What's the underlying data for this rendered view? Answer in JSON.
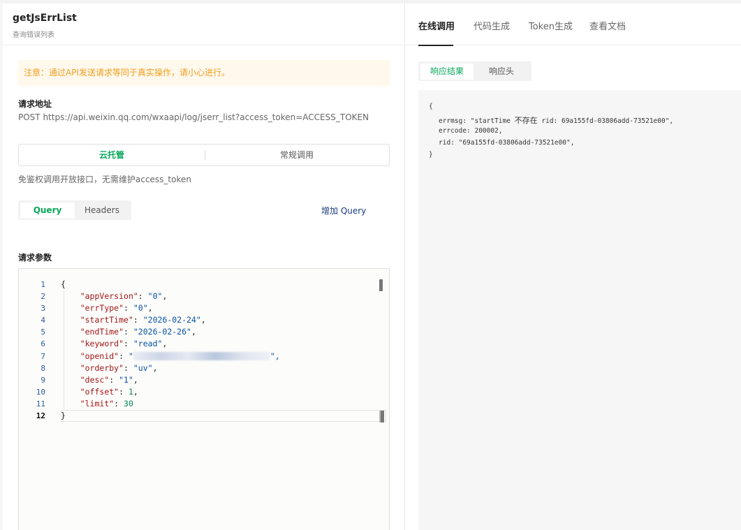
{
  "api": {
    "title": "getJsErrList",
    "subtitle": "查询错误列表"
  },
  "notice": "注意：通过API发送请求等同于真实操作，请小心进行。",
  "request_url": {
    "label": "请求地址",
    "value": "POST https://api.weixin.qq.com/wxaapi/log/jserr_list?access_token=ACCESS_TOKEN"
  },
  "mode_switch": {
    "options": [
      "云托管",
      "常规调用"
    ],
    "selected": "云托管"
  },
  "hint": "免鉴权调用开放接口，无需维护access_token",
  "param_tabs": {
    "tabs": [
      "Query",
      "Headers"
    ],
    "active": "Query",
    "add_label": "增加 Query"
  },
  "params_label": "请求参数",
  "editor": {
    "line_numbers": [
      "1",
      "2",
      "3",
      "4",
      "5",
      "6",
      "7",
      "8",
      "9",
      "10",
      "11",
      "12"
    ],
    "current_line": "12",
    "open_brace": "{",
    "close_brace": "}",
    "entries": [
      {
        "key": "\"appVersion\"",
        "value": "\"0\"",
        "kind": "s",
        "sep": ","
      },
      {
        "key": "\"errType\"",
        "value": "\"0\"",
        "kind": "s",
        "sep": ","
      },
      {
        "key": "\"startTime\"",
        "value": "\"2026-02-24\"",
        "kind": "s",
        "sep": ","
      },
      {
        "key": "\"endTime\"",
        "value": "\"2026-02-26\"",
        "kind": "s",
        "sep": ","
      },
      {
        "key": "\"keyword\"",
        "value": "\"read\"",
        "kind": "s",
        "sep": ","
      },
      {
        "key": "\"openid\"",
        "value": "\"",
        "kind": "s",
        "sep": "\",",
        "redacted": true
      },
      {
        "key": "\"orderby\"",
        "value": "\"uv\"",
        "kind": "s",
        "sep": ","
      },
      {
        "key": "\"desc\"",
        "value": "\"1\"",
        "kind": "s",
        "sep": ","
      },
      {
        "key": "\"offset\"",
        "value": "1",
        "kind": "n",
        "sep": ","
      },
      {
        "key": "\"limit\"",
        "value": "30",
        "kind": "n",
        "sep": ""
      }
    ]
  },
  "right_nav": {
    "tabs": [
      "在线调用",
      "代码生成",
      "Token生成",
      "查看文档"
    ],
    "active": "在线调用"
  },
  "response_tabs": {
    "tabs": [
      "响应结果",
      "响应头"
    ],
    "active": "响应结果"
  },
  "response": {
    "open": "{",
    "errmsg_prefix": "errmsg: \"startTime ",
    "errmsg_cn": "不存在",
    "errmsg_suffix": " rid: 69a155fd-03806add-73521e00\",",
    "errcode": "errcode: 200002,",
    "rid": "rid: \"69a155fd-03806add-73521e00\",",
    "close": "}"
  },
  "colors": {
    "accent": "#07a85a",
    "notice_text": "#f0a020",
    "notice_bg": "#fff8ec",
    "link": "#1a3a7a"
  }
}
